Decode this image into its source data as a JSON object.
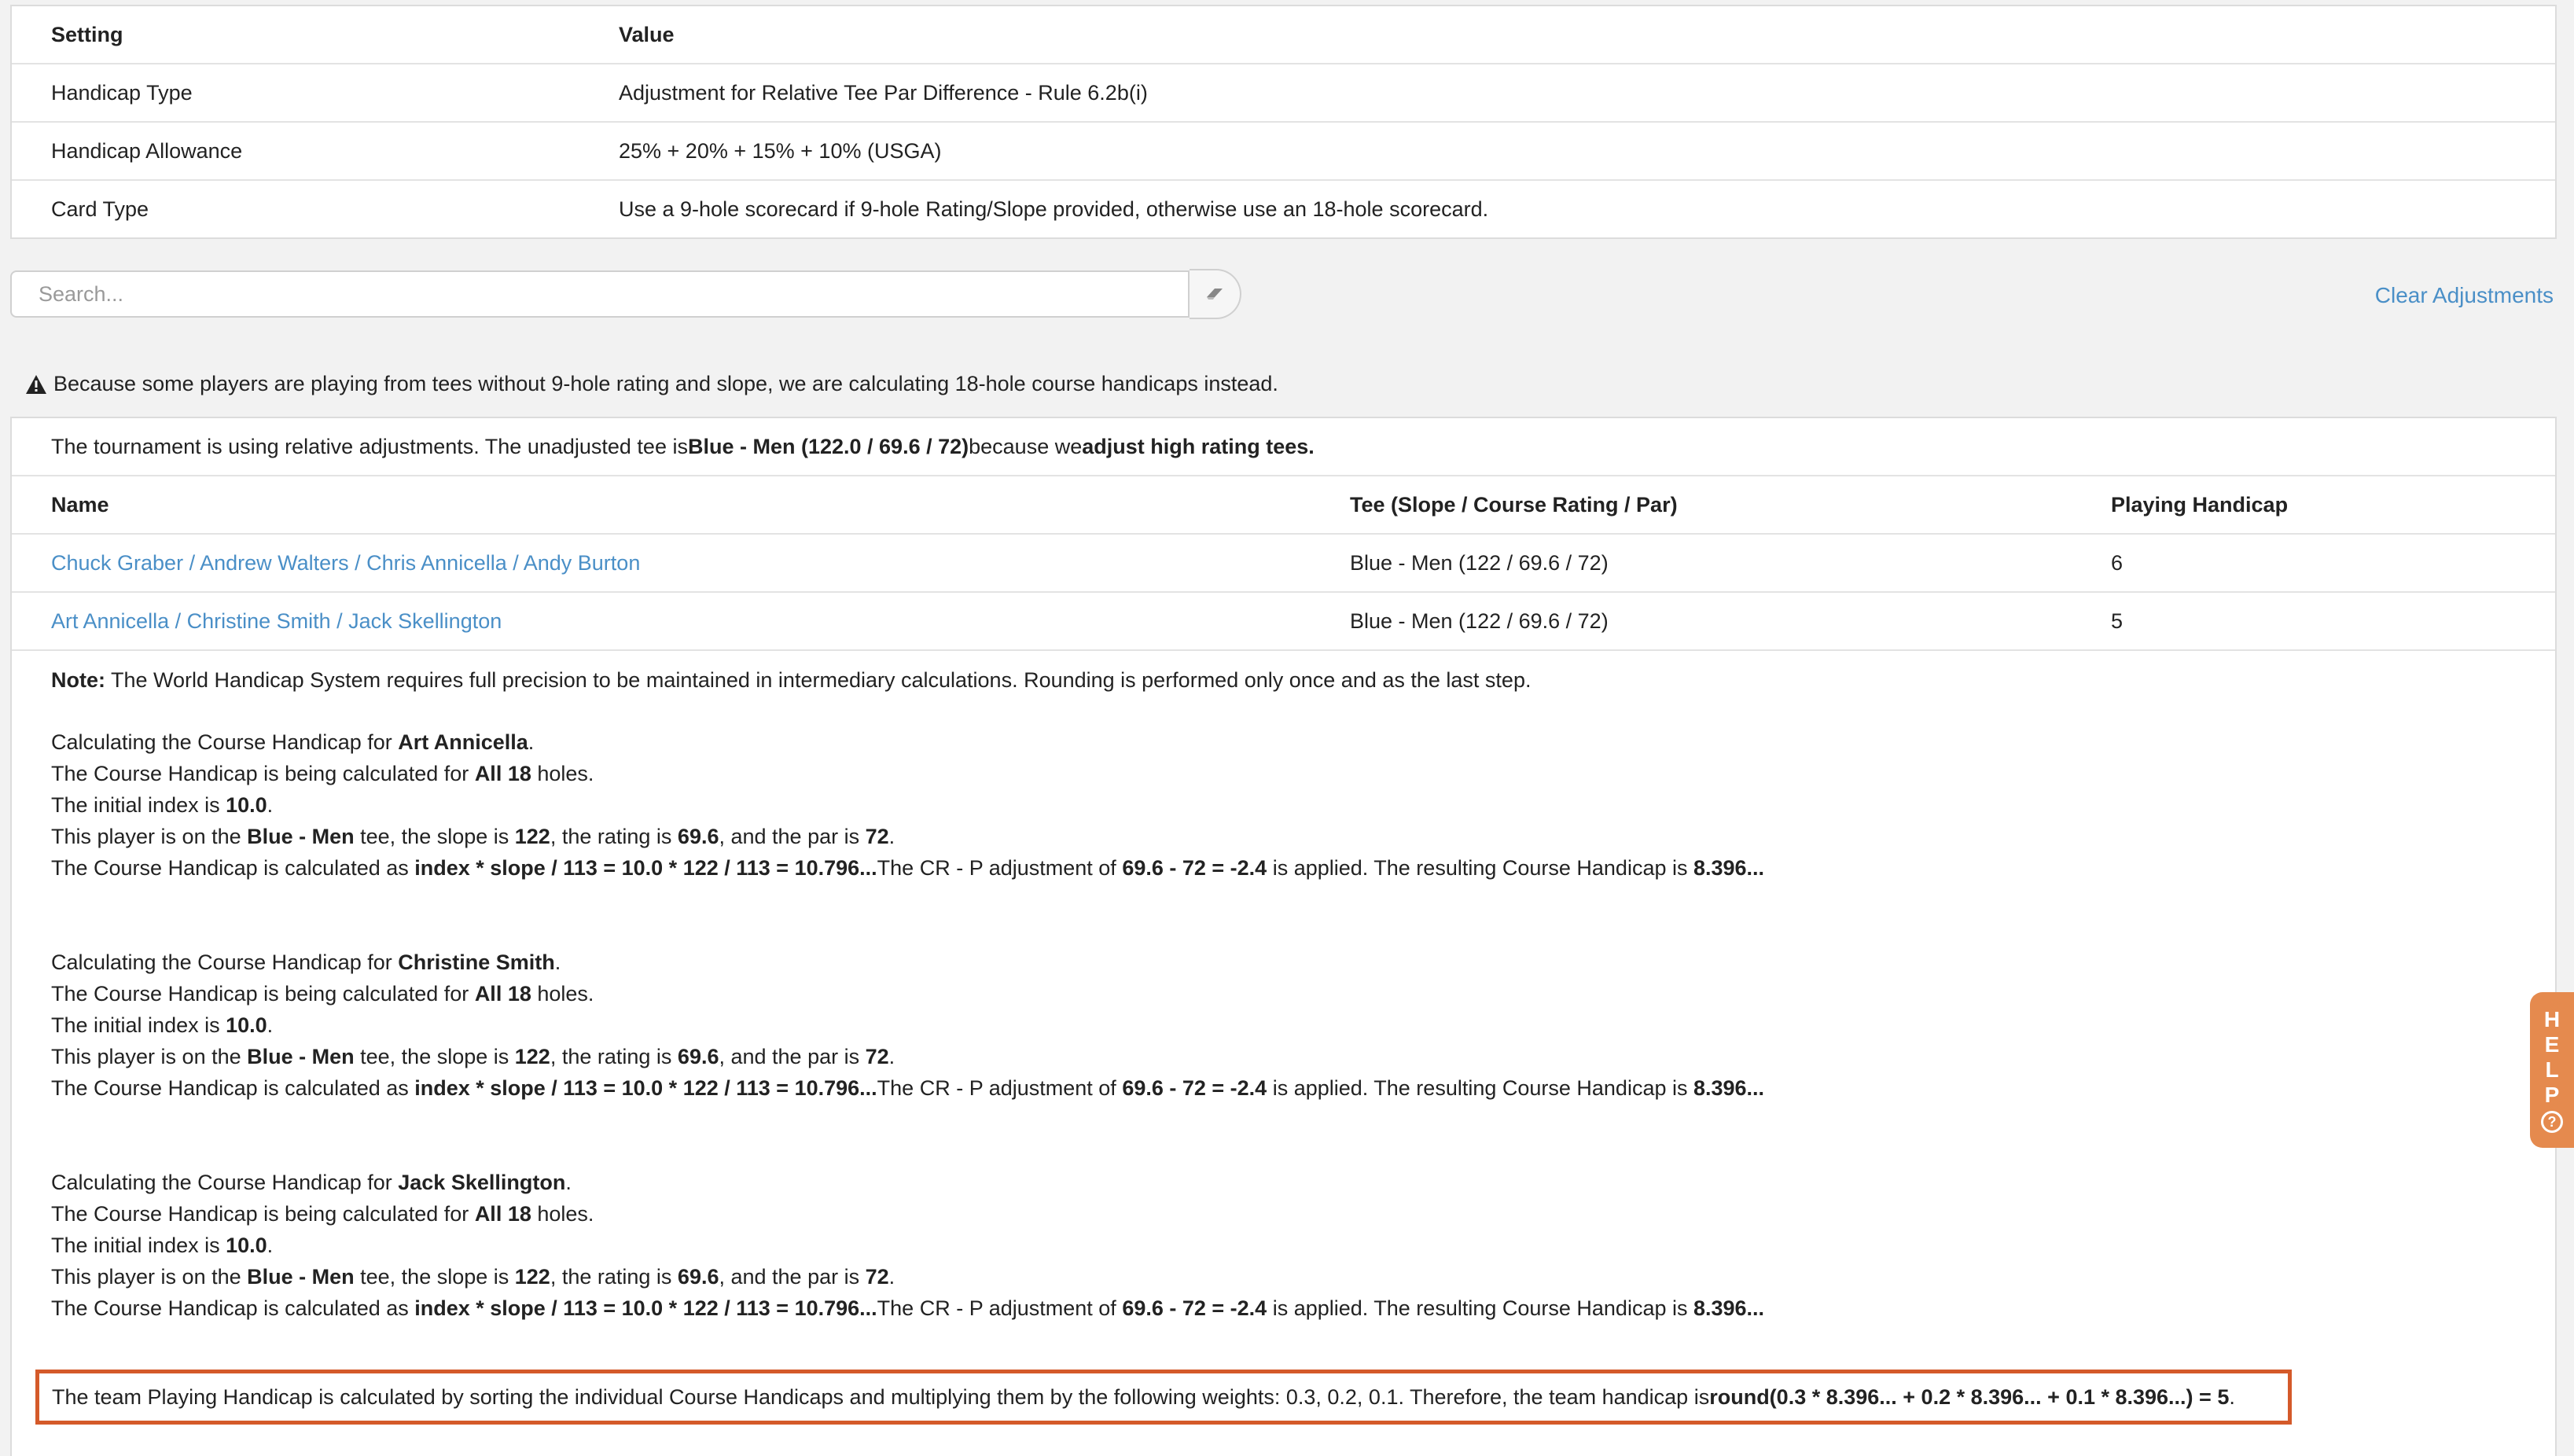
{
  "settings": {
    "header": {
      "setting": "Setting",
      "value": "Value"
    },
    "rows": [
      {
        "setting": "Handicap Type",
        "value": "Adjustment for Relative Tee Par Difference - Rule 6.2b(i)"
      },
      {
        "setting": "Handicap Allowance",
        "value": "25% + 20% + 15% + 10% (USGA)"
      },
      {
        "setting": "Card Type",
        "value": "Use a 9-hole scorecard if 9-hole Rating/Slope provided, otherwise use an 18-hole scorecard."
      }
    ]
  },
  "search": {
    "placeholder": "Search...",
    "button_icon": "eraser-icon"
  },
  "clear_adjustments": "Clear Adjustments",
  "warning": "Because some players are playing from tees without 9-hole rating and slope, we are calculating 18-hole course handicaps instead.",
  "notice": {
    "prefix": "The tournament is using relative adjustments. The unadjusted tee is ",
    "tee": "Blue - Men (122.0 / 69.6 / 72)",
    "middle": " because we ",
    "reason": "adjust high rating tees."
  },
  "table": {
    "headers": {
      "name": "Name",
      "tee": "Tee (Slope / Course Rating / Par)",
      "handicap": "Playing Handicap"
    },
    "rows": [
      {
        "name": "Chuck Graber / Andrew Walters / Chris Annicella / Andy Burton",
        "tee": "Blue - Men (122 / 69.6 / 72)",
        "handicap": "6"
      },
      {
        "name": "Art Annicella / Christine Smith / Jack Skellington",
        "tee": "Blue - Men (122 / 69.6 / 72)",
        "handicap": "5"
      }
    ]
  },
  "note": {
    "label": "Note:",
    "text": " The World Handicap System requires full precision to be maintained in intermediary calculations. Rounding is performed only once and as the last step."
  },
  "calculations": [
    {
      "player": "Art Annicella",
      "holes": "All 18",
      "index": "10.0",
      "tee": "Blue - Men",
      "slope": "122",
      "rating": "69.6",
      "par": "72",
      "formula": "index * slope / 113 = 10.0 * 122 / 113 = 10.796...",
      "adjustment": "69.6 - 72 = -2.4",
      "result": "8.396..."
    },
    {
      "player": "Christine Smith",
      "holes": "All 18",
      "index": "10.0",
      "tee": "Blue - Men",
      "slope": "122",
      "rating": "69.6",
      "par": "72",
      "formula": "index * slope / 113 = 10.0 * 122 / 113 = 10.796...",
      "adjustment": "69.6 - 72 = -2.4",
      "result": "8.396..."
    },
    {
      "player": "Jack Skellington",
      "holes": "All 18",
      "index": "10.0",
      "tee": "Blue - Men",
      "slope": "122",
      "rating": "69.6",
      "par": "72",
      "formula": "index * slope / 113 = 10.0 * 122 / 113 = 10.796...",
      "adjustment": "69.6 - 72 = -2.4",
      "result": "8.396..."
    }
  ],
  "calc_text": {
    "l1_prefix": "Calculating the Course Handicap for ",
    "l2_prefix": "The Course Handicap is being calculated for ",
    "l2_suffix": " holes.",
    "l3_prefix": "The initial index is ",
    "l4_prefix": "This player is on the ",
    "l4_slope": " tee, the slope is ",
    "l4_rating": ", the rating is ",
    "l4_par": ", and the par is ",
    "l5_prefix": "The Course Handicap is calculated as ",
    "l5_adj": "The CR - P adjustment of ",
    "l5_applied": " is applied. The resulting Course Handicap is ",
    "period": "."
  },
  "final": {
    "text": "The team Playing Handicap is calculated by sorting the individual Course Handicaps and multiplying them by the following weights: 0.3, 0.2, 0.1. Therefore, the team handicap is ",
    "formula": "round(0.3 * 8.396... + 0.2 * 8.396... + 0.1 * 8.396...) = 5",
    "period": "."
  },
  "help": {
    "letters": [
      "H",
      "E",
      "L",
      "P"
    ],
    "icon": "?"
  },
  "colors": {
    "link": "#4a8fc7",
    "highlight_border": "#d45a2a",
    "help_tab": "#e58a4e"
  }
}
